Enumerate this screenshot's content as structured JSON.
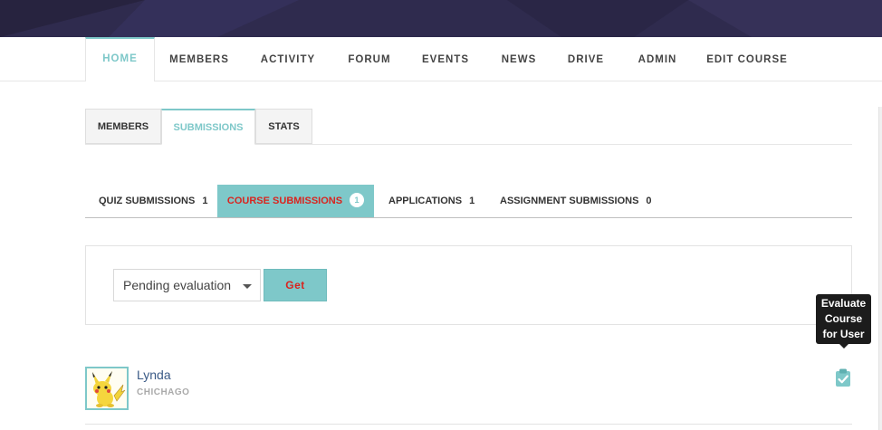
{
  "nav": {
    "items": [
      {
        "label": "HOME",
        "active": true
      },
      {
        "label": "MEMBERS",
        "active": false
      },
      {
        "label": "ACTIVITY",
        "active": false
      },
      {
        "label": "FORUM",
        "active": false
      },
      {
        "label": "EVENTS",
        "active": false
      },
      {
        "label": "NEWS",
        "active": false
      },
      {
        "label": "DRIVE",
        "active": false
      },
      {
        "label": "ADMIN",
        "active": false
      },
      {
        "label": "EDIT COURSE",
        "active": false
      }
    ]
  },
  "subtabs": [
    {
      "label": "MEMBERS",
      "active": false
    },
    {
      "label": "SUBMISSIONS",
      "active": true
    },
    {
      "label": "STATS",
      "active": false
    }
  ],
  "submission_tabs": [
    {
      "label": "QUIZ SUBMISSIONS",
      "count": "1",
      "active": false
    },
    {
      "label": "COURSE SUBMISSIONS",
      "count": "1",
      "active": true
    },
    {
      "label": "APPLICATIONS",
      "count": "1",
      "active": false
    },
    {
      "label": "ASSIGNMENT SUBMISSIONS",
      "count": "0",
      "active": false
    }
  ],
  "filter": {
    "selected": "Pending evaluation",
    "get_label": "Get"
  },
  "tooltip": {
    "lines": [
      "Evaluate",
      "Course",
      "for User"
    ]
  },
  "submissions": [
    {
      "name": "Lynda",
      "location": "CHICHAGO",
      "avatar_icon": "pikachu-avatar",
      "action_icon": "clipboard-check-icon"
    }
  ],
  "colors": {
    "accent": "#7ec8c9",
    "alert_text": "#d9241f",
    "banner": "#2e2a4d"
  }
}
